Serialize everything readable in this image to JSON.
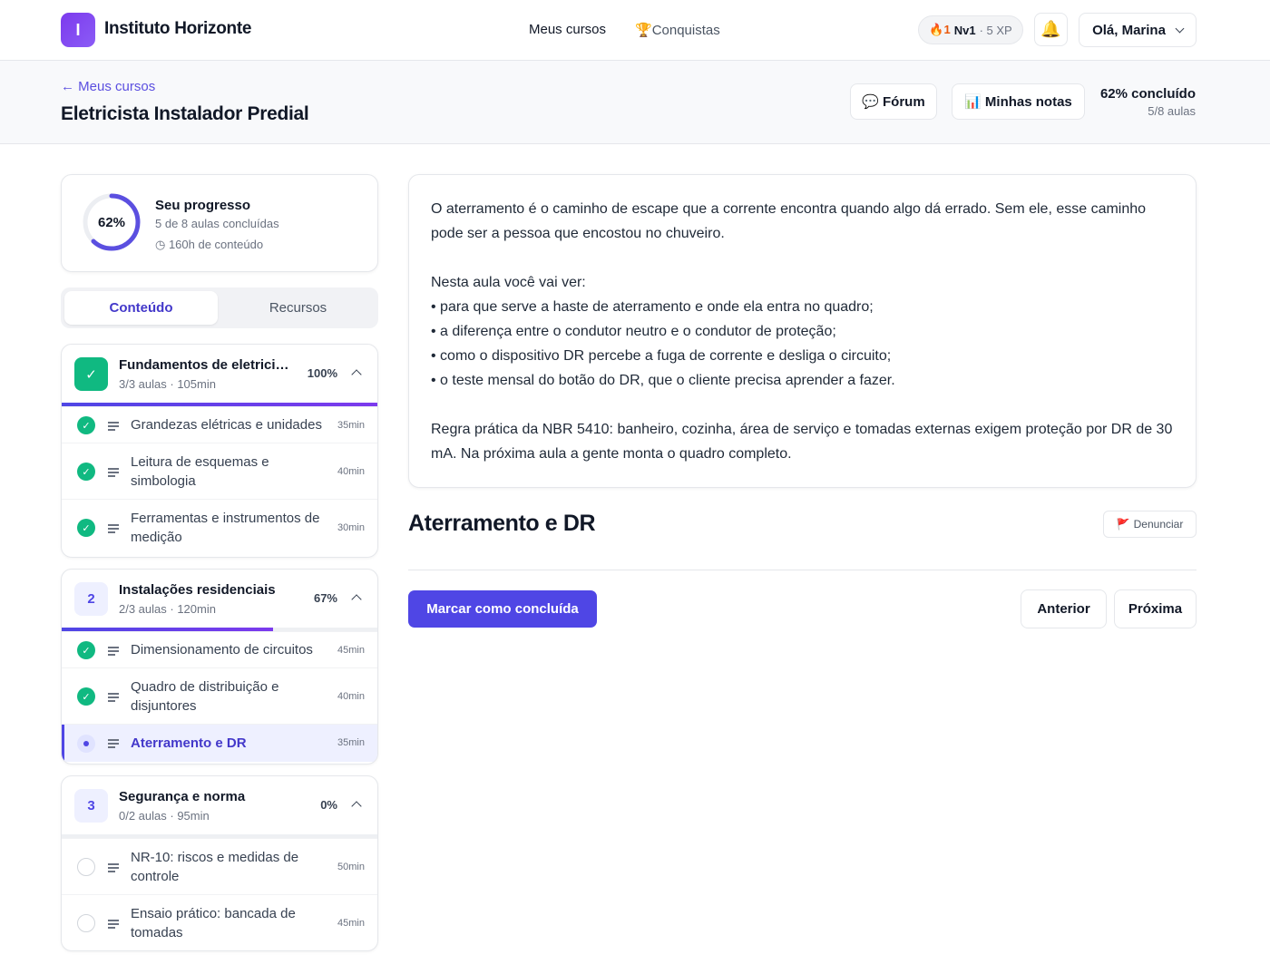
{
  "app": {
    "logo_letter": "I",
    "brand": "Instituto Horizonte",
    "accent_color": "#4f46e5",
    "success_color": "#10b981"
  },
  "nav": {
    "my_courses": "Meus cursos",
    "achievements": "Conquistas",
    "achievements_icon": "trophy-icon",
    "streak": "1",
    "streak_icon": "fire-icon",
    "level": "Nv1",
    "xp": "· 5 XP",
    "bell_icon": "bell-icon",
    "user_greeting": "Olá, Marina"
  },
  "course": {
    "back_label": "← Meus cursos",
    "title": "Eletricista Instalador Predial",
    "forum_label": "Fórum",
    "forum_icon": "speech-bubble-icon",
    "notes_label": "Minhas notas",
    "notes_icon": "bar-chart-icon",
    "completion": "62% concluído",
    "lessons_count": "5/8 aulas"
  },
  "progress": {
    "percent_value": 62,
    "percent_label": "62%",
    "title": "Seu progresso",
    "completed": "5 de 8 aulas concluídas",
    "hours": "◷ 160h de conteúdo"
  },
  "tabs": {
    "content": "Conteúdo",
    "resources": "Recursos"
  },
  "modules": [
    {
      "badge": "✓",
      "title": "Fundamentos de eletricidade",
      "meta": "3/3 aulas · 105min",
      "pct": "100%",
      "progress": 1.0,
      "lessons": [
        {
          "title": "Grandezas elétricas e unidades",
          "duration": "35min",
          "status": "done"
        },
        {
          "title": "Leitura de esquemas e simbologia",
          "duration": "40min",
          "status": "done"
        },
        {
          "title": "Ferramentas e instrumentos de medição",
          "duration": "30min",
          "status": "done"
        }
      ]
    },
    {
      "badge": "2",
      "title": "Instalações residenciais",
      "meta": "2/3 aulas · 120min",
      "pct": "67%",
      "progress": 0.67,
      "lessons": [
        {
          "title": "Dimensionamento de circuitos",
          "duration": "45min",
          "status": "done"
        },
        {
          "title": "Quadro de distribuição e disjuntores",
          "duration": "40min",
          "status": "done"
        },
        {
          "title": "Aterramento e DR",
          "duration": "35min",
          "status": "current"
        }
      ]
    },
    {
      "badge": "3",
      "title": "Segurança e norma",
      "meta": "0/2 aulas · 95min",
      "pct": "0%",
      "progress": 0.0,
      "lessons": [
        {
          "title": "NR-10: riscos e medidas de controle",
          "duration": "50min",
          "status": "pending"
        },
        {
          "title": "Ensaio prático: bancada de tomadas",
          "duration": "45min",
          "status": "pending"
        }
      ]
    }
  ],
  "lesson": {
    "intro": "O aterramento é o caminho de escape que a corrente encontra quando algo dá errado. Sem ele, esse caminho pode ser a pessoa que encostou no chuveiro.",
    "list_heading": "Nesta aula você vai ver:",
    "bullets": [
      "• para que serve a haste de aterramento e onde ela entra no quadro;",
      "• a diferença entre o condutor neutro e o condutor de proteção;",
      "• como o dispositivo DR percebe a fuga de corrente e desliga o circuito;",
      "• o teste mensal do botão do DR, que o cliente precisa aprender a fazer."
    ],
    "rule": "Regra prática da NBR 5410: banheiro, cozinha, área de serviço e tomadas externas exigem proteção por DR de 30 mA. Na próxima aula a gente monta o quadro completo.",
    "title": "Aterramento e DR",
    "report_label": "Denunciar",
    "report_icon": "flag-icon",
    "complete_label": "Marcar como concluída",
    "prev_label": "Anterior",
    "next_label": "Próxima"
  }
}
